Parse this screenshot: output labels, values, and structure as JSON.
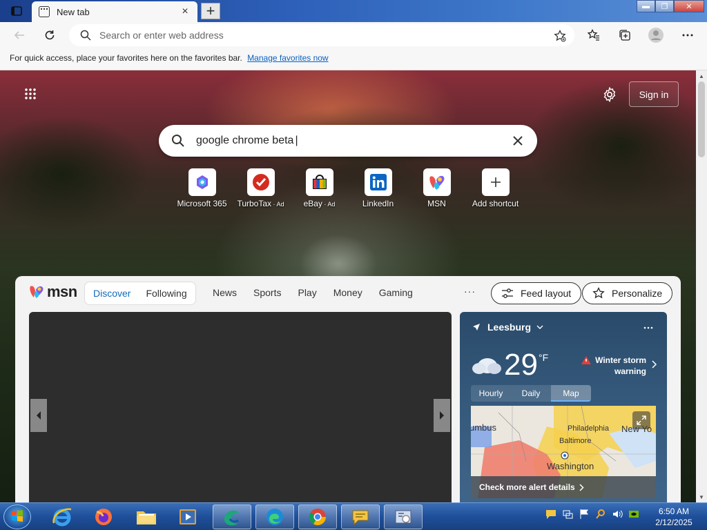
{
  "tab": {
    "title": "New tab",
    "close": "×",
    "new_tab": "+"
  },
  "window": {
    "minimize": "▬",
    "maximize": "❐",
    "close": "✕"
  },
  "toolbar": {
    "address_placeholder": "Search or enter web address"
  },
  "favbar": {
    "text": "For quick access, place your favorites here on the favorites bar.",
    "link": "Manage favorites now"
  },
  "page": {
    "signin": "Sign in",
    "search_query": "google chrome beta",
    "shortcuts": [
      {
        "label": "Microsoft 365",
        "ad": "",
        "icon": "microsoft365-icon"
      },
      {
        "label": "TurboTax",
        "ad": " · Ad",
        "icon": "turbotax-icon"
      },
      {
        "label": "eBay",
        "ad": " · Ad",
        "icon": "ebay-icon"
      },
      {
        "label": "LinkedIn",
        "ad": "",
        "icon": "linkedin-icon"
      },
      {
        "label": "MSN",
        "ad": "",
        "icon": "msn-icon"
      },
      {
        "label": "Add shortcut",
        "ad": "",
        "icon": "plus-icon"
      }
    ]
  },
  "msn": {
    "logo": "msn",
    "segment": [
      "Discover",
      "Following"
    ],
    "nav": [
      "News",
      "Sports",
      "Play",
      "Money",
      "Gaming"
    ],
    "more": "···",
    "feed_layout": "Feed layout",
    "personalize": "Personalize"
  },
  "weather": {
    "location": "Leesburg",
    "temp": "29",
    "unit": "°F",
    "alert_line1": "Winter storm",
    "alert_line2": "warning",
    "tabs": [
      "Hourly",
      "Daily",
      "Map"
    ],
    "active_tab": "Map",
    "map_labels": [
      "umbus",
      "Philadelphia",
      "Baltimore",
      "New Yo",
      "Washington",
      "Leesburg"
    ],
    "cta": "Check more alert details"
  },
  "taskbar": {
    "time": "6:50 AM",
    "date": "2/12/2025",
    "apps": [
      "internet-explorer-icon",
      "firefox-icon",
      "file-explorer-icon",
      "media-player-icon",
      "app-icon",
      "edge-icon",
      "chrome-icon",
      "chat-icon",
      "control-panel-icon"
    ]
  },
  "colors": {
    "accent": "#0f6cbd",
    "taskbar": "#1f4f9a",
    "alert": "#e0413a"
  }
}
